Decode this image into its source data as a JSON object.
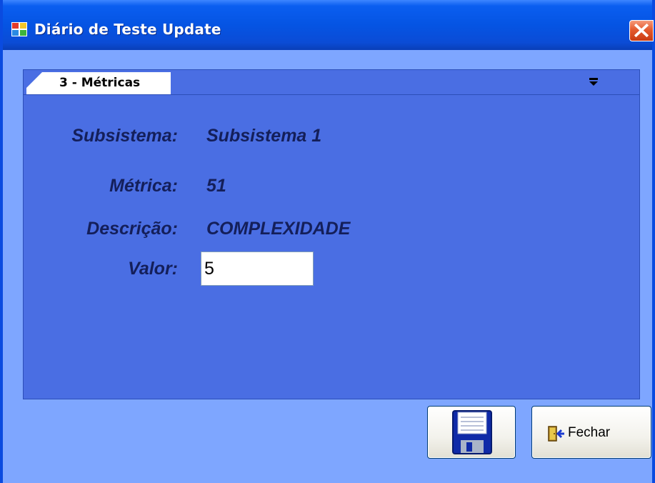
{
  "window": {
    "title": "Diário de Teste Update",
    "icon": "window-app-icon",
    "close_icon": "close-icon"
  },
  "tab": {
    "label": "3 - Métricas",
    "menu_icon": "dropdown-menu-icon"
  },
  "form": {
    "subsistema_label": "Subsistema:",
    "subsistema_value": "Subsistema 1",
    "metrica_label": "Métrica:",
    "metrica_value": "51",
    "descricao_label": "Descrição:",
    "descricao_value": "COMPLEXIDADE",
    "valor_label": "Valor:",
    "valor_value": "5"
  },
  "buttons": {
    "save_icon": "floppy-disk-icon",
    "close_label": "Fechar",
    "close_icon": "exit-door-icon"
  },
  "colors": {
    "title_bar": "#0554e3",
    "window_bg": "#7ea6ff",
    "panel_bg": "#4a6ee3",
    "close_red": "#e45a2e",
    "label_text": "#141f5a"
  }
}
